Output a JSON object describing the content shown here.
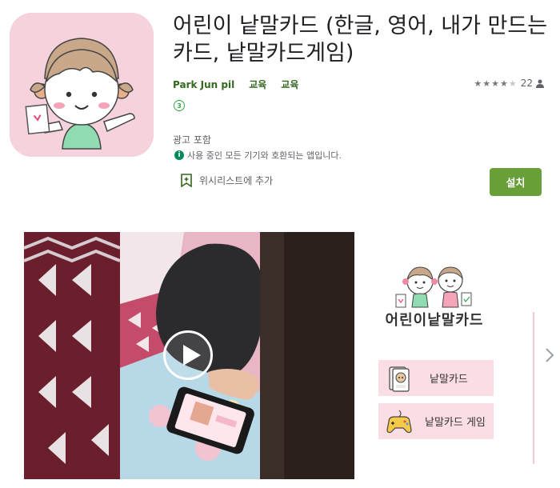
{
  "app": {
    "title": "어린이 낱말카드 (한글, 영어, 내가 만드는 카드, 낱말카드게임)",
    "developer": "Park Jun pil",
    "category_primary": "교육",
    "category_secondary": "교육",
    "rating": {
      "stars": 4,
      "max_stars": 5,
      "count": "22"
    },
    "content_rating": "3",
    "ads_label": "광고 포함",
    "compatibility": "사용 중인 모든 기기와 호환되는 앱입니다.",
    "wishlist_label": "위시리스트에 추가",
    "install_label": "설치",
    "accent_color": "#689f38",
    "icon_background": "#f6d2dc"
  },
  "screenshot": {
    "brand": "어린이낱말카드",
    "buttons": [
      {
        "label": "낱말카드",
        "icon": "word-card-icon"
      },
      {
        "label": "낱말카드 게임",
        "icon": "gamepad-icon"
      }
    ]
  },
  "icons": {
    "play": "play-icon",
    "next": "chevron-right-icon",
    "info": "info-icon",
    "wishlist": "bookmark-add-icon",
    "person": "person-icon"
  }
}
